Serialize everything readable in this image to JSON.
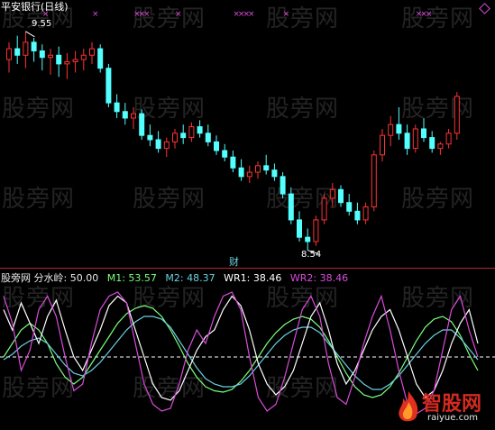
{
  "header": {
    "title": "平安银行(日线)",
    "high_label": "9.55",
    "low_label": "8.54",
    "event_marker": "财"
  },
  "indicator": {
    "name": "股旁网 分水岭:",
    "name_value": "50.00",
    "m1_label": "M1:",
    "m1_value": "53.57",
    "m2_label": "M2:",
    "m2_value": "48.37",
    "wr1_label": "WR1:",
    "wr1_value": "38.46",
    "wr2_label": "WR2:",
    "wr2_value": "38.46"
  },
  "watermark": {
    "text": "股旁网"
  },
  "logo": {
    "text": "智股网",
    "url": "raiyue.com"
  },
  "colors": {
    "up": "#ff3232",
    "down": "#54ffff",
    "neutral": "#ffffff",
    "m1": "#7cff7c",
    "m2": "#6ad0e0",
    "wr1": "#ffffff",
    "wr2": "#d94cd9",
    "marks": "#d94cd9"
  },
  "chart_data": [
    {
      "type": "candlestick",
      "title": "平安银行(日线)",
      "annotations": [
        {
          "label": "9.55",
          "kind": "high"
        },
        {
          "label": "8.54",
          "kind": "low"
        }
      ],
      "ohlc": [
        [
          9.42,
          9.5,
          9.36,
          9.47
        ],
        [
          9.47,
          9.53,
          9.4,
          9.44
        ],
        [
          9.44,
          9.55,
          9.38,
          9.5
        ],
        [
          9.5,
          9.52,
          9.41,
          9.46
        ],
        [
          9.46,
          9.49,
          9.37,
          9.43
        ],
        [
          9.43,
          9.47,
          9.35,
          9.44
        ],
        [
          9.44,
          9.48,
          9.34,
          9.4
        ],
        [
          9.4,
          9.45,
          9.33,
          9.41
        ],
        [
          9.41,
          9.46,
          9.36,
          9.42
        ],
        [
          9.42,
          9.47,
          9.37,
          9.44
        ],
        [
          9.44,
          9.5,
          9.4,
          9.47
        ],
        [
          9.47,
          9.49,
          9.36,
          9.38
        ],
        [
          9.38,
          9.4,
          9.2,
          9.22
        ],
        [
          9.22,
          9.26,
          9.15,
          9.18
        ],
        [
          9.18,
          9.22,
          9.12,
          9.15
        ],
        [
          9.15,
          9.2,
          9.1,
          9.17
        ],
        [
          9.17,
          9.19,
          9.05,
          9.07
        ],
        [
          9.07,
          9.12,
          9.02,
          9.05
        ],
        [
          9.05,
          9.09,
          8.99,
          9.01
        ],
        [
          9.01,
          9.06,
          8.97,
          9.04
        ],
        [
          9.04,
          9.1,
          9.01,
          9.08
        ],
        [
          9.08,
          9.12,
          9.03,
          9.06
        ],
        [
          9.06,
          9.13,
          9.04,
          9.11
        ],
        [
          9.11,
          9.14,
          9.06,
          9.08
        ],
        [
          9.08,
          9.12,
          9.02,
          9.04
        ],
        [
          9.04,
          9.07,
          8.98,
          9.0
        ],
        [
          9.0,
          9.03,
          8.95,
          8.97
        ],
        [
          8.97,
          9.0,
          8.9,
          8.92
        ],
        [
          8.92,
          8.96,
          8.86,
          8.88
        ],
        [
          8.88,
          8.93,
          8.85,
          8.9
        ],
        [
          8.9,
          8.95,
          8.87,
          8.93
        ],
        [
          8.93,
          8.98,
          8.89,
          8.91
        ],
        [
          8.91,
          8.94,
          8.86,
          8.88
        ],
        [
          8.88,
          8.9,
          8.78,
          8.8
        ],
        [
          8.8,
          8.83,
          8.66,
          8.68
        ],
        [
          8.68,
          8.72,
          8.58,
          8.6
        ],
        [
          8.6,
          8.64,
          8.54,
          8.58
        ],
        [
          8.58,
          8.7,
          8.56,
          8.68
        ],
        [
          8.68,
          8.8,
          8.66,
          8.78
        ],
        [
          8.78,
          8.85,
          8.74,
          8.82
        ],
        [
          8.82,
          8.84,
          8.74,
          8.76
        ],
        [
          8.76,
          8.8,
          8.7,
          8.72
        ],
        [
          8.72,
          8.76,
          8.66,
          8.68
        ],
        [
          8.68,
          8.76,
          8.66,
          8.74
        ],
        [
          8.74,
          9.0,
          8.72,
          8.98
        ],
        [
          8.98,
          9.1,
          8.95,
          9.07
        ],
        [
          9.07,
          9.16,
          9.02,
          9.12
        ],
        [
          9.12,
          9.2,
          9.05,
          9.08
        ],
        [
          9.08,
          9.12,
          8.98,
          9.01
        ],
        [
          9.01,
          9.12,
          8.99,
          9.1
        ],
        [
          9.1,
          9.15,
          9.04,
          9.06
        ],
        [
          9.06,
          9.09,
          8.99,
          9.01
        ],
        [
          9.01,
          9.04,
          8.98,
          9.03
        ],
        [
          9.03,
          9.1,
          9.01,
          9.08
        ],
        [
          9.08,
          9.27,
          9.05,
          9.25
        ]
      ]
    },
    {
      "type": "line",
      "title": "股旁网 分水岭",
      "reference_line": 50.0,
      "ylim": [
        0,
        100
      ],
      "series": [
        {
          "name": "M1",
          "values": [
            50,
            60,
            70,
            75,
            70,
            60,
            45,
            35,
            30,
            35,
            45,
            55,
            65,
            75,
            82,
            86,
            88,
            86,
            80,
            70,
            58,
            45,
            35,
            28,
            25,
            24,
            26,
            32,
            40,
            50,
            60,
            68,
            74,
            78,
            80,
            78,
            72,
            62,
            50,
            38,
            28,
            22,
            20,
            22,
            28,
            38,
            50,
            62,
            72,
            78,
            80,
            76,
            66,
            52,
            40
          ]
        },
        {
          "name": "M2",
          "values": [
            48,
            52,
            58,
            62,
            64,
            60,
            52,
            44,
            38,
            36,
            40,
            46,
            54,
            62,
            70,
            76,
            80,
            80,
            78,
            72,
            62,
            52,
            42,
            34,
            30,
            28,
            28,
            30,
            36,
            44,
            52,
            60,
            66,
            70,
            72,
            72,
            68,
            60,
            52,
            44,
            36,
            30,
            26,
            26,
            30,
            36,
            44,
            52,
            60,
            66,
            70,
            70,
            64,
            56,
            48
          ]
        },
        {
          "name": "WR1",
          "values": [
            85,
            70,
            90,
            75,
            60,
            80,
            92,
            70,
            50,
            40,
            55,
            70,
            88,
            95,
            90,
            70,
            50,
            30,
            20,
            18,
            25,
            40,
            55,
            65,
            70,
            85,
            95,
            88,
            70,
            45,
            30,
            22,
            28,
            40,
            60,
            80,
            90,
            70,
            45,
            30,
            40,
            55,
            70,
            80,
            85,
            70,
            50,
            30,
            20,
            25,
            40,
            60,
            75,
            85,
            60
          ]
        },
        {
          "name": "WR2",
          "values": [
            95,
            75,
            40,
            55,
            85,
            95,
            80,
            50,
            25,
            30,
            60,
            85,
            95,
            98,
            90,
            60,
            30,
            15,
            10,
            12,
            30,
            55,
            70,
            60,
            80,
            95,
            98,
            85,
            50,
            20,
            10,
            15,
            35,
            60,
            85,
            95,
            80,
            45,
            20,
            15,
            35,
            60,
            80,
            95,
            70,
            40,
            15,
            8,
            12,
            25,
            55,
            85,
            95,
            70,
            50
          ]
        }
      ]
    }
  ]
}
